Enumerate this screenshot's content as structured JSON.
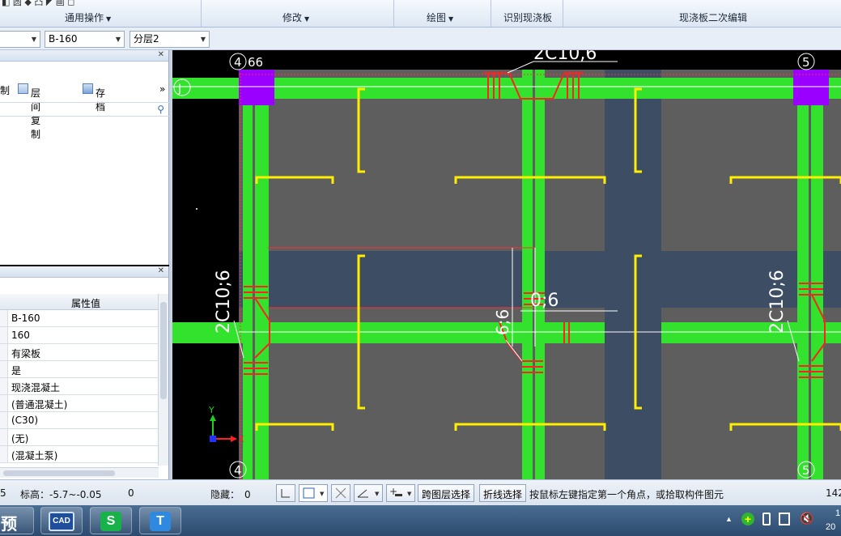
{
  "ribbon": {
    "groups": [
      "通用操作",
      "修改",
      "绘图",
      "识别现浇板",
      "现浇板二次编辑"
    ]
  },
  "selectors": {
    "type_value": "B-160",
    "layer_value": "分层2"
  },
  "layer_panel": {
    "toolbar": {
      "copy_label": "层间复制",
      "archive_label": "存档",
      "left_partial": "制"
    }
  },
  "property_panel": {
    "header": "属性值",
    "values": [
      "B-160",
      "160",
      "有梁板",
      "是",
      "现浇混凝土",
      "(普通混凝土)",
      "(C30)",
      "(无)",
      "(混凝土泵)"
    ]
  },
  "drawing": {
    "axis_labels": {
      "top_left": "4",
      "top_left_b": "66",
      "top_right": "5",
      "row_j": "J",
      "bottom_left": "4",
      "bottom_right": "5"
    },
    "rebar_labels": {
      "top": "2C10,6",
      "left": "2C10;6",
      "right": "2C10;6",
      "center": "0;6",
      "center_b": "6;6"
    },
    "ucs": {
      "y": "Y",
      "x": "X"
    }
  },
  "status": {
    "left_num": "5",
    "elevation": "标高：-5.7~-0.05",
    "zero": "0",
    "hidden": "隐藏：",
    "hidden_value": "0",
    "btn_cross_layer": "跨图层选择",
    "btn_polyline": "折线选择",
    "hint": "按鼠标左键指定第一个角点，或拾取构件图元",
    "right_num": "142"
  },
  "taskbar": {
    "app1_label": "预",
    "app2_label": "CAD",
    "app3_label": "S",
    "app4_label": "T",
    "clock_partial": "1",
    "date_partial": "20"
  },
  "colors": {
    "slab_gray": "#5e5e5e",
    "beam_green": "#33e22d",
    "column_blue": "#3c4d64",
    "column_purple": "#9a00ff",
    "rebar_yellow": "#ffee00",
    "rebar_red": "#ff2020"
  }
}
